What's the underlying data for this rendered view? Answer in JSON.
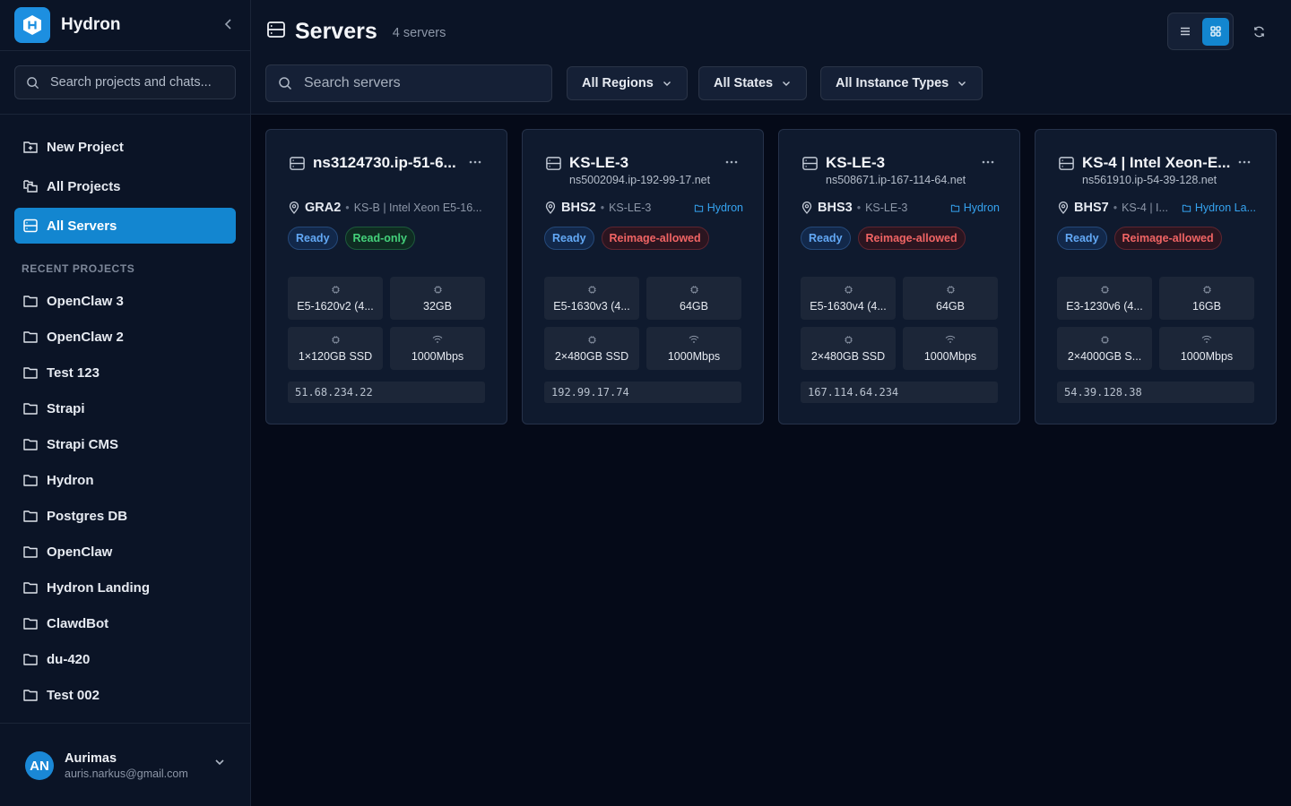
{
  "app": {
    "name": "Hydron"
  },
  "sidebar": {
    "search_placeholder": "Search projects and chats...",
    "nav": [
      {
        "label": "New Project",
        "icon": "folder-plus-icon"
      },
      {
        "label": "All Projects",
        "icon": "folders-icon"
      },
      {
        "label": "All Servers",
        "icon": "server-icon",
        "active": true
      }
    ],
    "recent_label": "RECENT PROJECTS",
    "projects": [
      "OpenClaw 3",
      "OpenClaw 2",
      "Test 123",
      "Strapi",
      "Strapi CMS",
      "Hydron",
      "Postgres DB",
      "OpenClaw",
      "Hydron Landing",
      "ClawdBot",
      "du-420",
      "Test 002"
    ],
    "user": {
      "initials": "AN",
      "name": "Aurimas",
      "email": "auris.narkus@gmail.com"
    }
  },
  "header": {
    "title": "Servers",
    "count": "4 servers",
    "search_placeholder": "Search servers",
    "filters": [
      "All Regions",
      "All States",
      "All Instance Types"
    ]
  },
  "servers": [
    {
      "title": "ns3124730.ip-51-6...",
      "host": "",
      "region": "GRA2",
      "type": "KS-B | Intel Xeon E5-16...",
      "project": "",
      "badges": [
        {
          "label": "Ready",
          "kind": "ready"
        },
        {
          "label": "Read-only",
          "kind": "readonly"
        }
      ],
      "cpu": "E5-1620v2 (4...",
      "ram": "32GB",
      "disk": "1×120GB SSD",
      "net": "1000Mbps",
      "ip": "51.68.234.22"
    },
    {
      "title": "KS-LE-3",
      "host": "ns5002094.ip-192-99-17.net",
      "region": "BHS2",
      "type": "KS-LE-3",
      "project": "Hydron",
      "badges": [
        {
          "label": "Ready",
          "kind": "ready"
        },
        {
          "label": "Reimage-allowed",
          "kind": "reimage"
        }
      ],
      "cpu": "E5-1630v3 (4...",
      "ram": "64GB",
      "disk": "2×480GB SSD",
      "net": "1000Mbps",
      "ip": "192.99.17.74"
    },
    {
      "title": "KS-LE-3",
      "host": "ns508671.ip-167-114-64.net",
      "region": "BHS3",
      "type": "KS-LE-3",
      "project": "Hydron",
      "badges": [
        {
          "label": "Ready",
          "kind": "ready"
        },
        {
          "label": "Reimage-allowed",
          "kind": "reimage"
        }
      ],
      "cpu": "E5-1630v4 (4...",
      "ram": "64GB",
      "disk": "2×480GB SSD",
      "net": "1000Mbps",
      "ip": "167.114.64.234"
    },
    {
      "title": "KS-4 | Intel Xeon-E...",
      "host": "ns561910.ip-54-39-128.net",
      "region": "BHS7",
      "type": "KS-4 | I...",
      "project": "Hydron La...",
      "badges": [
        {
          "label": "Ready",
          "kind": "ready"
        },
        {
          "label": "Reimage-allowed",
          "kind": "reimage"
        }
      ],
      "cpu": "E3-1230v6 (4...",
      "ram": "16GB",
      "disk": "2×4000GB S...",
      "net": "1000Mbps",
      "ip": "54.39.128.38"
    }
  ],
  "colors": {
    "accent": "#1386d0",
    "background": "#050a18",
    "panel": "#0b1426"
  }
}
